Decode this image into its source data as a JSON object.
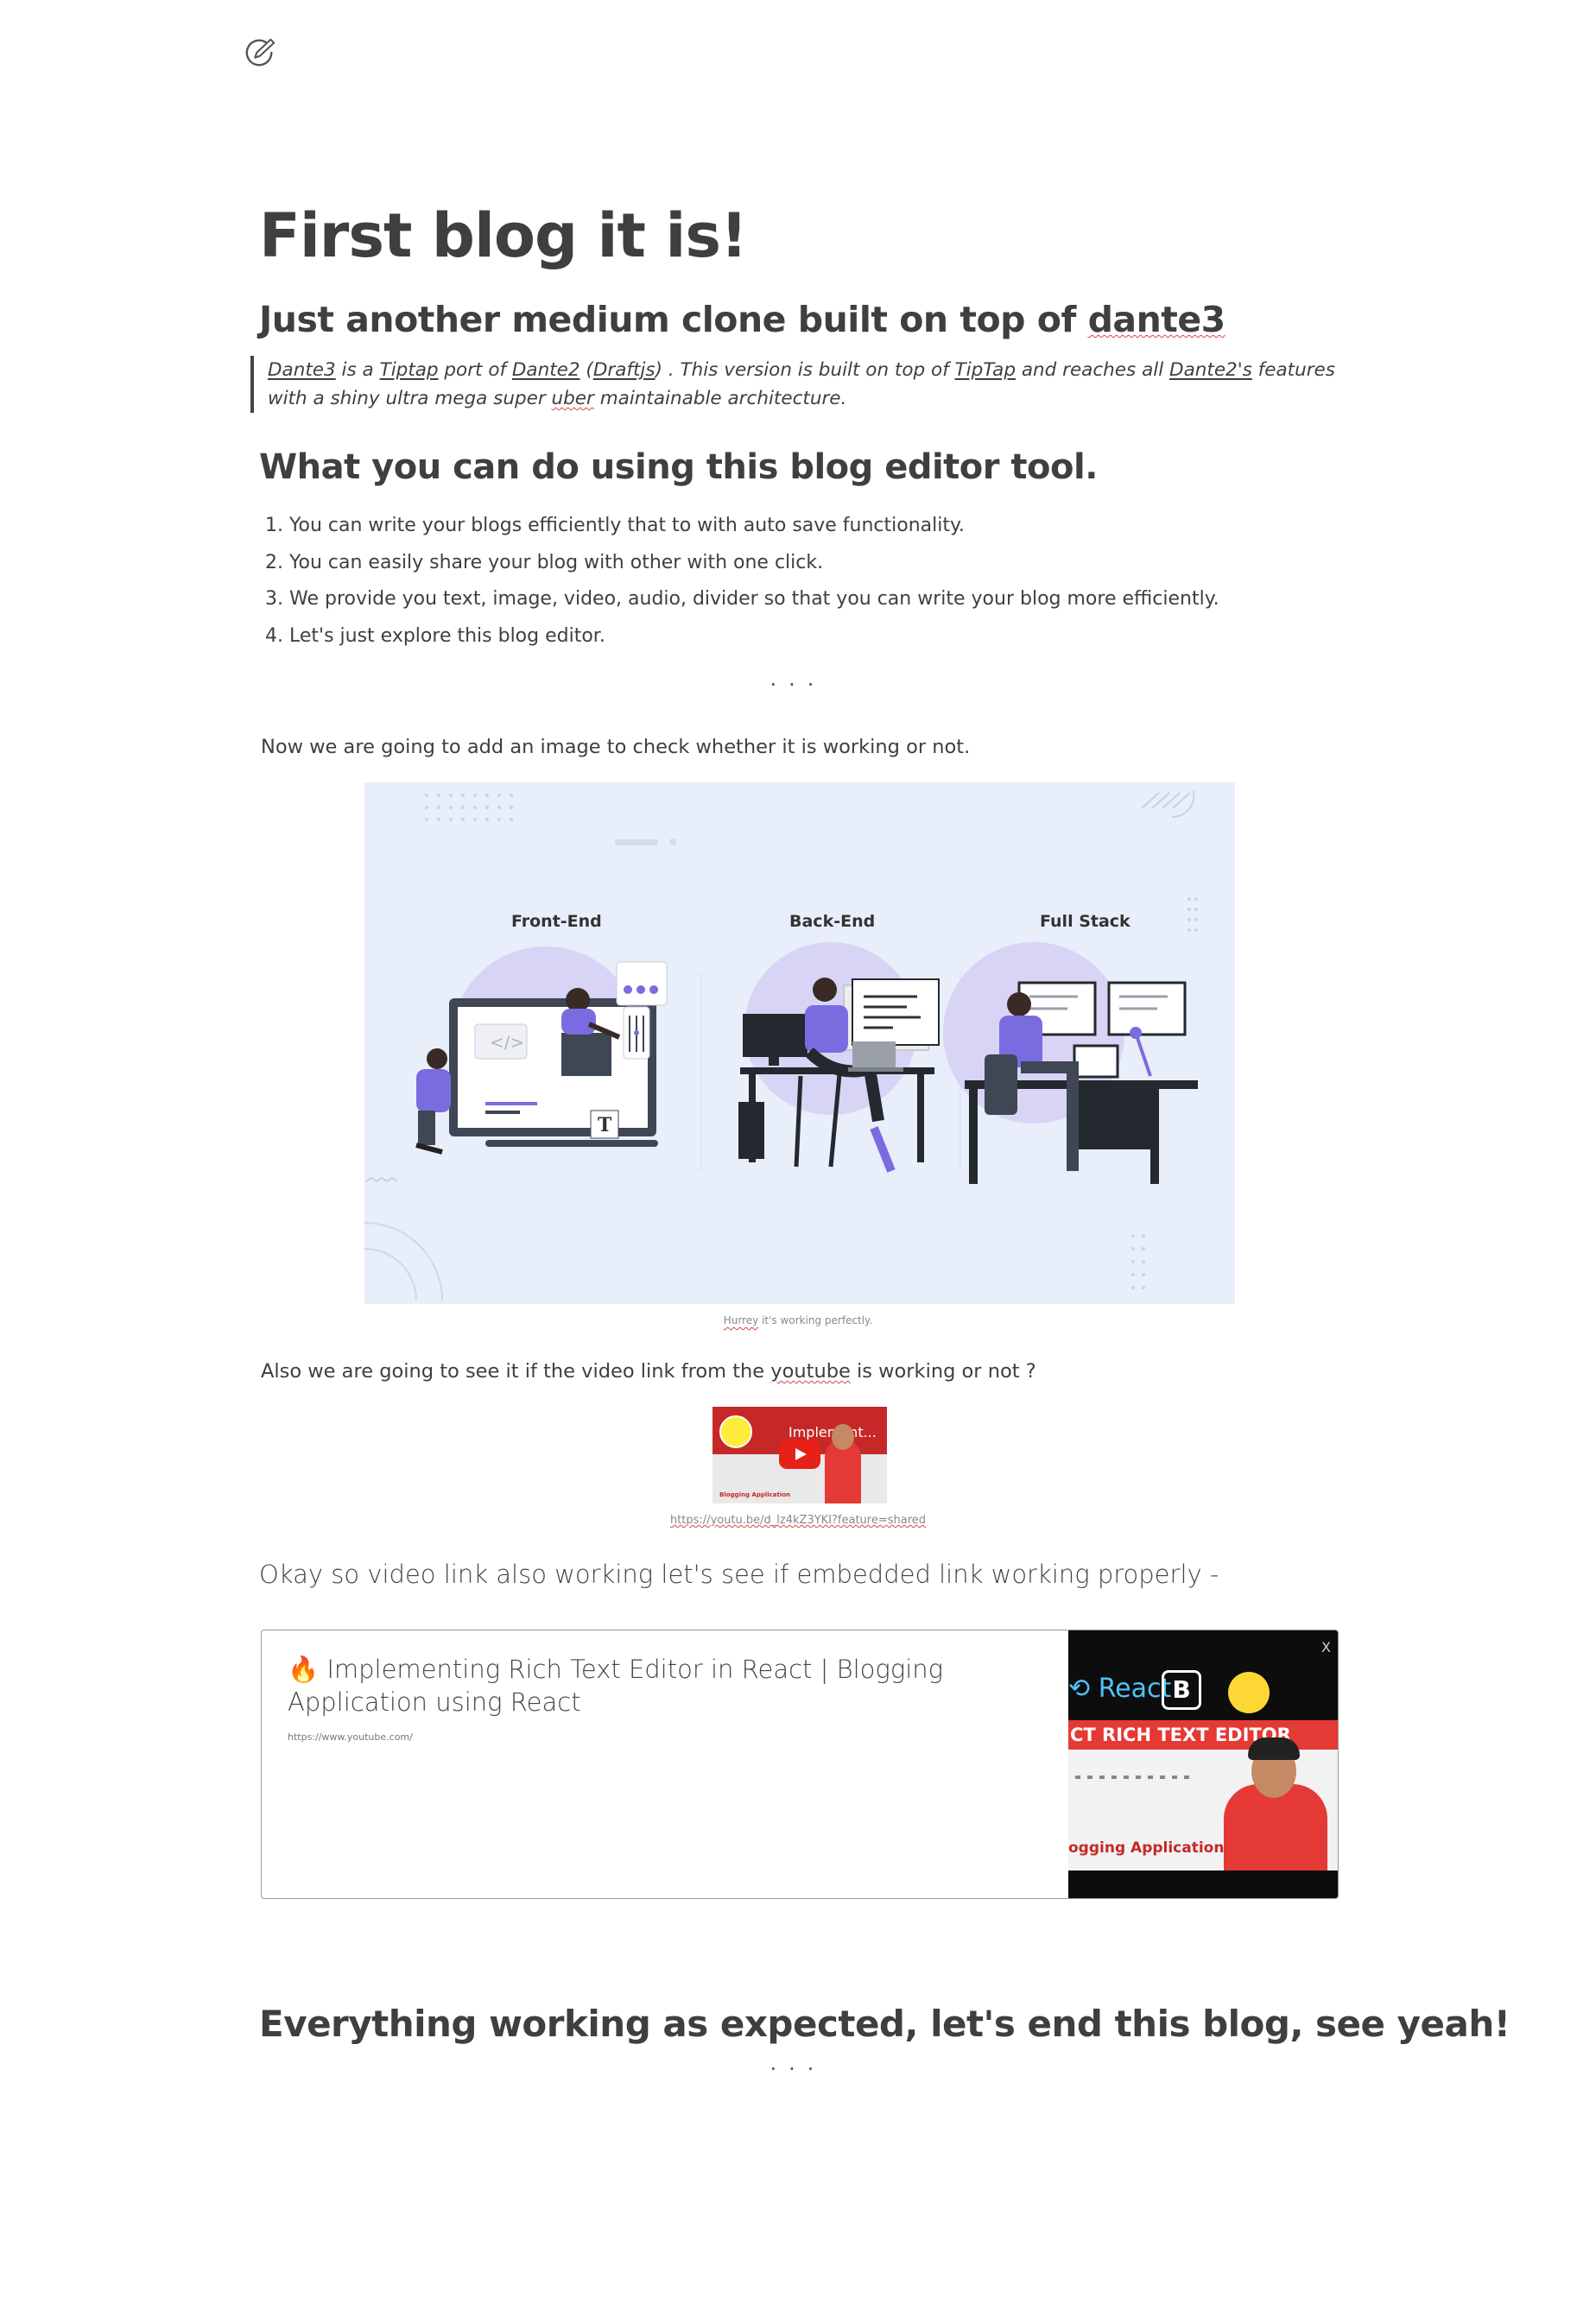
{
  "header": {
    "logo_icon": "pen-check-icon"
  },
  "post": {
    "title": "First blog it is!",
    "subtitle": {
      "text": "Just another medium clone built on top of ",
      "link": "dante3"
    },
    "quote": {
      "p1": "Dante3",
      "p2": " is a ",
      "p3": "Tiptap",
      "p4": " port of ",
      "p5": "Dante2",
      "p6": " (",
      "p7": "Draftjs",
      "p8": ") . This version is built on top of ",
      "p9": "TipTap",
      "p10": " and reaches all ",
      "p11": "Dante2's",
      "p12": " features with a shiny ultra mega super ",
      "p13": "uber",
      "p14": " maintainable architecture."
    },
    "heading2": "What you can do using this blog editor tool.",
    "list": [
      "You can write your blogs efficiently that to with auto save functionality.",
      "You can easily share your blog with other with one click.",
      "We provide you text, image, video, audio, divider so that you can write your blog more efficiently.",
      "Let's just explore this blog editor."
    ],
    "divider": "...",
    "image_intro": "Now we are going to add an image to check whether it is working or not.",
    "image": {
      "labels": [
        "Front-End",
        "Back-End",
        "Full Stack"
      ],
      "caption_part1": "Hurrey",
      "caption_part2": " it's working perfectly."
    },
    "video_intro": {
      "before": "Also we are going to see it if the video link from the ",
      "link": "youtube",
      "after": " is working or not ?"
    },
    "video": {
      "thumb_text": "Implement...",
      "thumb_footer": "Blogging Application",
      "url": "https://youtu.be/d_lz4kZ3YKI?feature=shared"
    },
    "embed_intro": "Okay so video link also working let's see if embedded link working properly -",
    "embed": {
      "title": "🔥 Implementing Rich Text Editor in React | Blogging Application using React",
      "url": "https://www.youtube.com/",
      "close_label": "X",
      "thumb_react": "React",
      "thumb_bootstrap": "B",
      "thumb_banner": "CT RICH TEXT EDITOR",
      "thumb_footer": "ogging Application"
    },
    "closing": "Everything working as expected, let's end this blog, see yeah!"
  },
  "colors": {
    "text": "#3f3f3f",
    "hero_bg": "#e8eefa",
    "accent_purple": "#7a6ce0",
    "youtube_red": "#e62117",
    "banner_red": "#e53935"
  }
}
